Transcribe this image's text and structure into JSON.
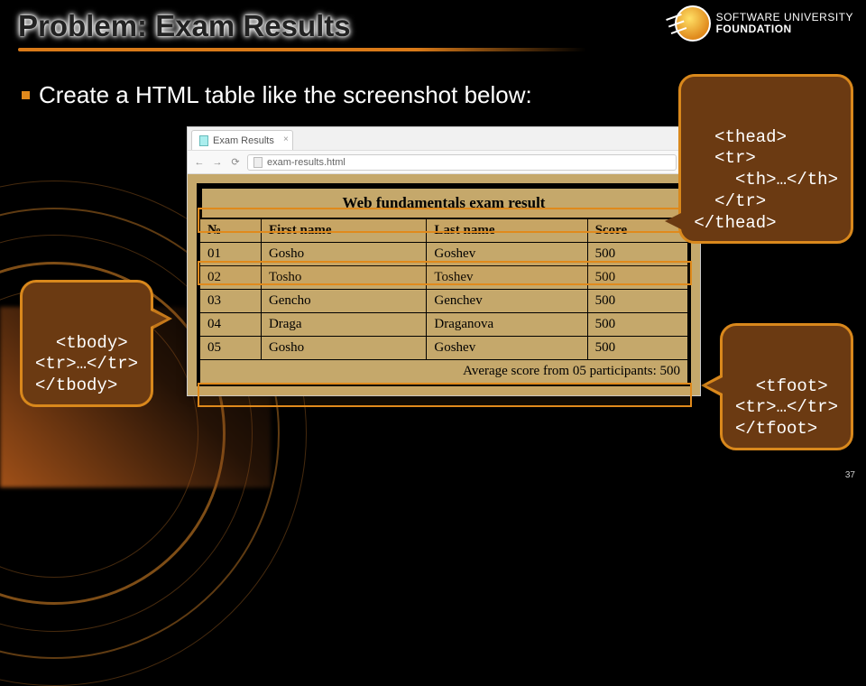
{
  "title": "Problem: Exam Results",
  "logo": {
    "line1": "SOFTWARE UNIVERSITY",
    "line2": "FOUNDATION"
  },
  "bullet": "Create a HTML table like the screenshot below:",
  "browser": {
    "tab_label": "Exam Results",
    "url": "exam-results.html"
  },
  "table": {
    "caption": "Web fundamentals exam result",
    "headers": [
      "№",
      "First name",
      "Last name",
      "Score"
    ],
    "rows": [
      [
        "01",
        "Gosho",
        "Goshev",
        "500"
      ],
      [
        "02",
        "Tosho",
        "Toshev",
        "500"
      ],
      [
        "03",
        "Gencho",
        "Genchev",
        "500"
      ],
      [
        "04",
        "Draga",
        "Draganova",
        "500"
      ],
      [
        "05",
        "Gosho",
        "Goshev",
        "500"
      ]
    ],
    "footer": "Average score from 05 participants: 500"
  },
  "callouts": {
    "thead": "<thead>\n  <tr>\n    <th>…</th>\n  </tr>\n</thead>",
    "tbody": "<tbody>\n<tr>…</tr>\n</tbody>",
    "tfoot": "<tfoot>\n<tr>…</tr>\n</tfoot>"
  },
  "slide_number": "37"
}
